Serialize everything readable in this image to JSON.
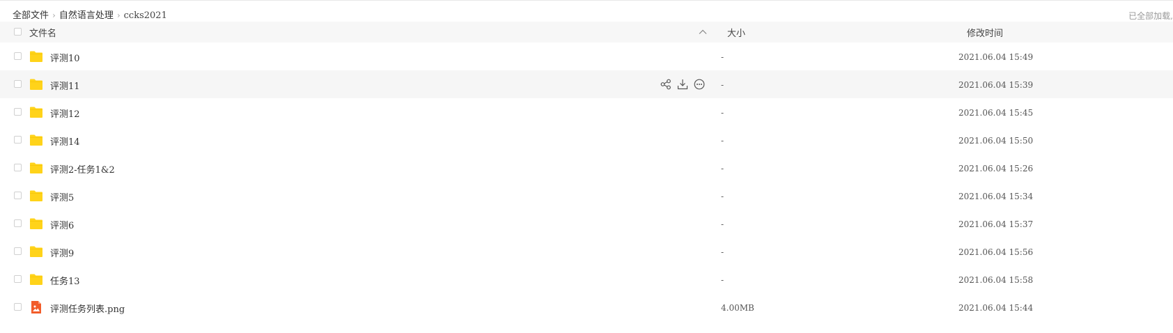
{
  "breadcrumb": {
    "items": [
      "全部文件",
      "自然语言处理",
      "ccks2021"
    ],
    "separator": "›"
  },
  "status": {
    "loaded_text": "已全部加载,"
  },
  "header": {
    "name_label": "文件名",
    "size_label": "大小",
    "modified_label": "修改时间",
    "sort_icon": "chevron-up-icon"
  },
  "files": [
    {
      "name": "评测10",
      "type": "folder",
      "size": "-",
      "modified": "2021.06.04 15:49"
    },
    {
      "name": "评测11",
      "type": "folder",
      "size": "-",
      "modified": "2021.06.04 15:39",
      "hovered": true
    },
    {
      "name": "评测12",
      "type": "folder",
      "size": "-",
      "modified": "2021.06.04 15:45"
    },
    {
      "name": "评测14",
      "type": "folder",
      "size": "-",
      "modified": "2021.06.04 15:50"
    },
    {
      "name": "评测2-任务1&2",
      "type": "folder",
      "size": "-",
      "modified": "2021.06.04 15:26"
    },
    {
      "name": "评测5",
      "type": "folder",
      "size": "-",
      "modified": "2021.06.04 15:34"
    },
    {
      "name": "评测6",
      "type": "folder",
      "size": "-",
      "modified": "2021.06.04 15:37"
    },
    {
      "name": "评测9",
      "type": "folder",
      "size": "-",
      "modified": "2021.06.04 15:56"
    },
    {
      "name": "任务13",
      "type": "folder",
      "size": "-",
      "modified": "2021.06.04 15:58"
    },
    {
      "name": "评测任务列表.png",
      "type": "image",
      "size": "4.00MB",
      "modified": "2021.06.04 15:44"
    }
  ],
  "row_actions": [
    "share-icon",
    "download-icon",
    "more-icon"
  ],
  "colors": {
    "folder": "#ffd31a",
    "image_file": "#f25c2a",
    "hover_row": "#f6f6f6",
    "header_bg": "#f7f7f7"
  }
}
